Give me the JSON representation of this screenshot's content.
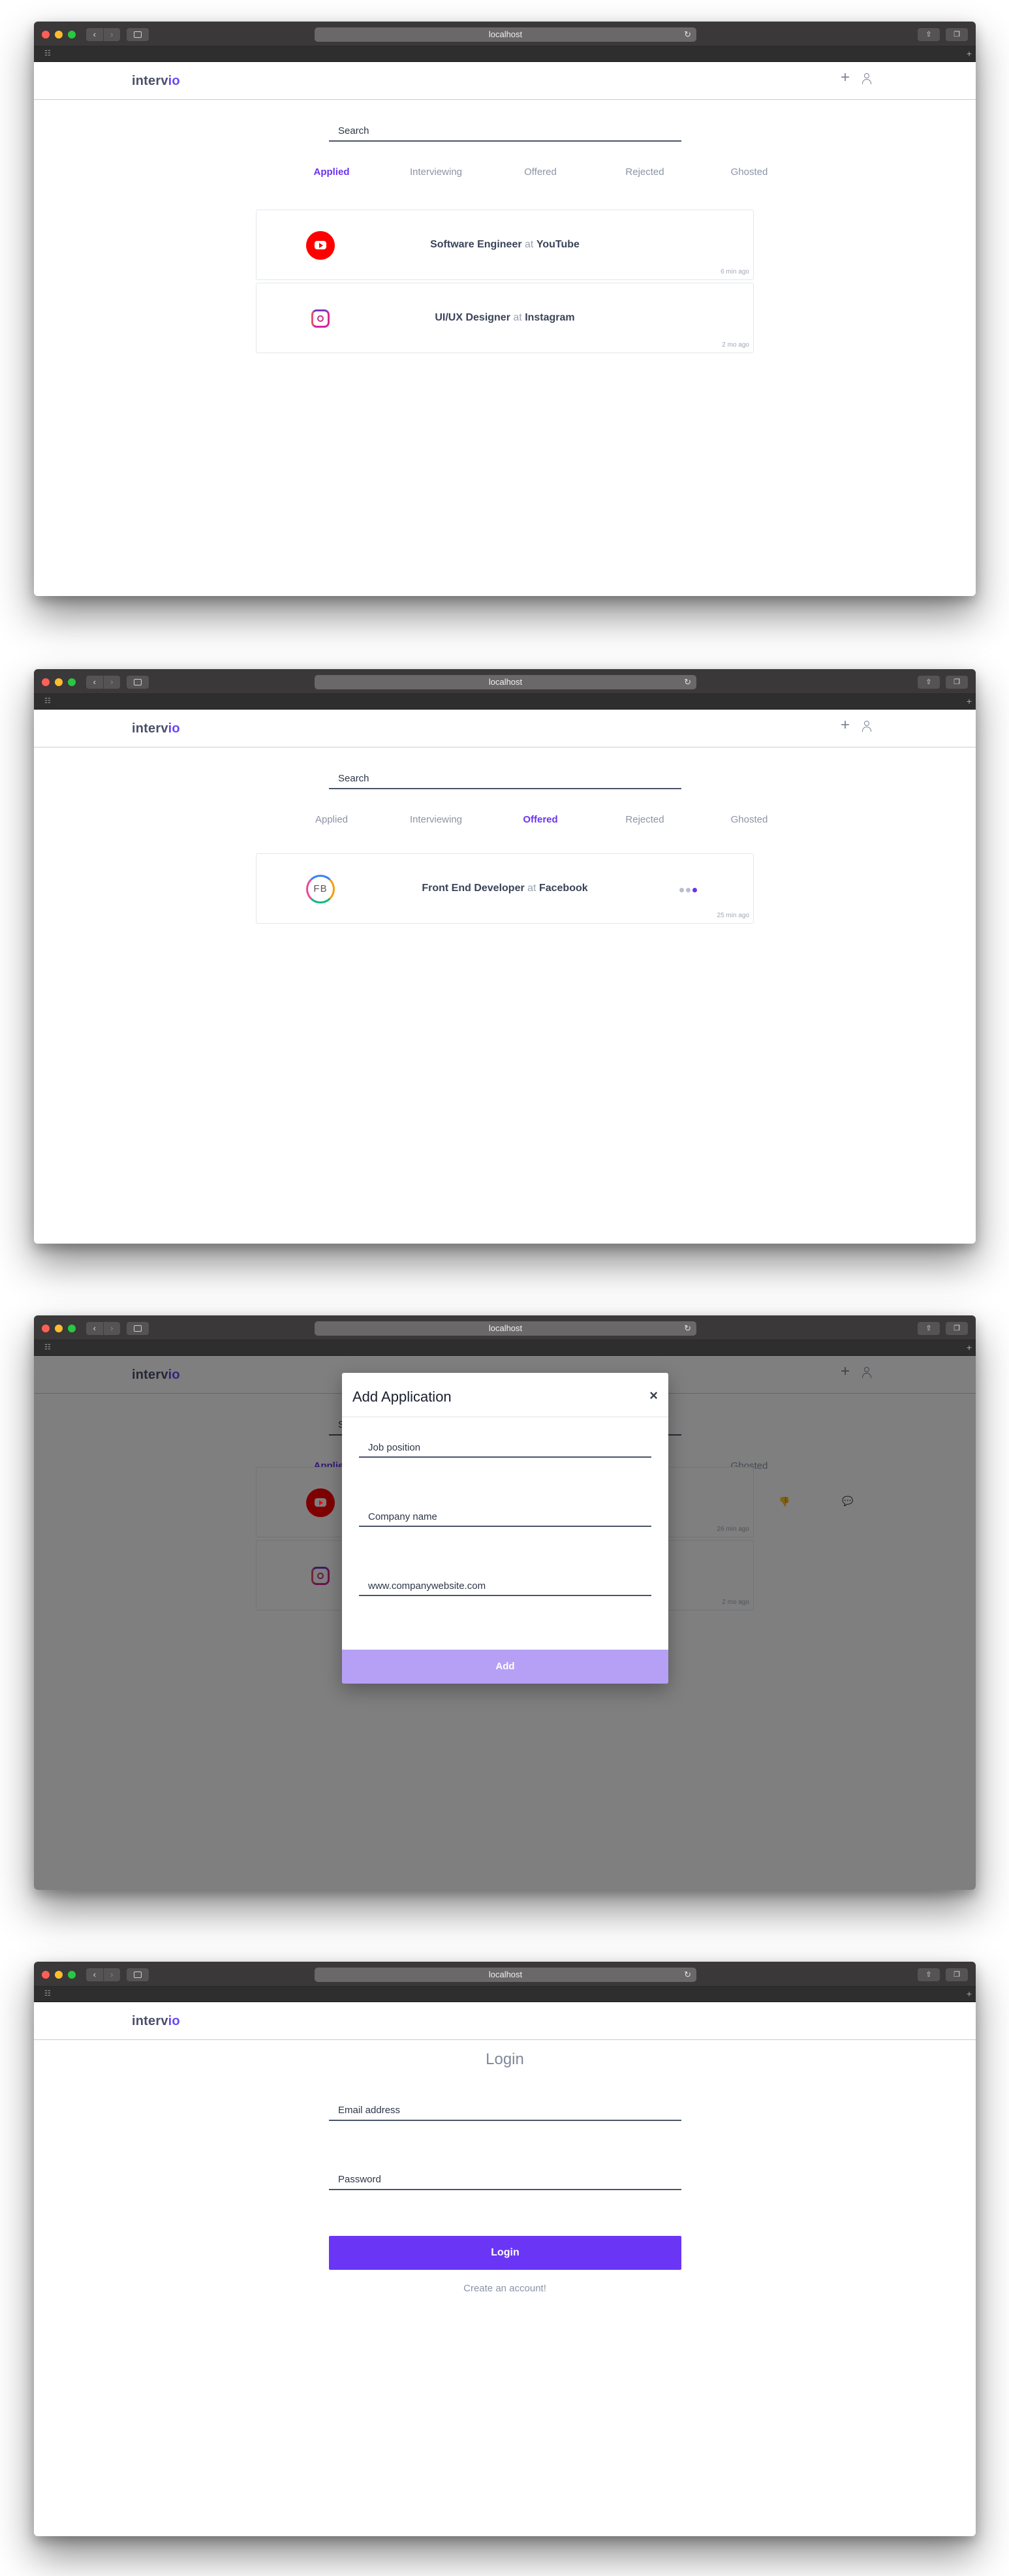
{
  "browser": {
    "url": "localhost"
  },
  "app": {
    "logo_main": "interv",
    "logo_accent": "io",
    "search_placeholder": "Search",
    "tabs": [
      "Applied",
      "Interviewing",
      "Offered",
      "Rejected",
      "Ghosted"
    ]
  },
  "screen1": {
    "active_tab": "Applied",
    "cards": [
      {
        "position": "Software Engineer",
        "at": "at",
        "company": "YouTube",
        "time": "6 min ago",
        "logo": "youtube-logo"
      },
      {
        "position": "UI/UX Designer",
        "at": "at",
        "company": "Instagram",
        "time": "2 mo ago",
        "logo": "instagram-logo"
      }
    ]
  },
  "screen2": {
    "active_tab": "Offered",
    "cards": [
      {
        "position": "Front End Developer",
        "at": "at",
        "company": "Facebook",
        "time": "25 min ago",
        "logo_text": "FB"
      }
    ]
  },
  "screen3": {
    "active_tab": "Applied",
    "bg_times": [
      "26 min ago",
      "2 mo ago"
    ],
    "modal": {
      "title": "Add Application",
      "close": "×",
      "job_placeholder": "Job position",
      "company_placeholder": "Company name",
      "website_placeholder": "www.companywebsite.com",
      "add_label": "Add"
    }
  },
  "screen4": {
    "title": "Login",
    "email_placeholder": "Email address",
    "password_placeholder": "Password",
    "login_label": "Login",
    "create_link": "Create an account!"
  },
  "colors": {
    "accent": "#6b33f1",
    "accent_light": "#b6a0f5",
    "titlebar": "#3a3838"
  }
}
